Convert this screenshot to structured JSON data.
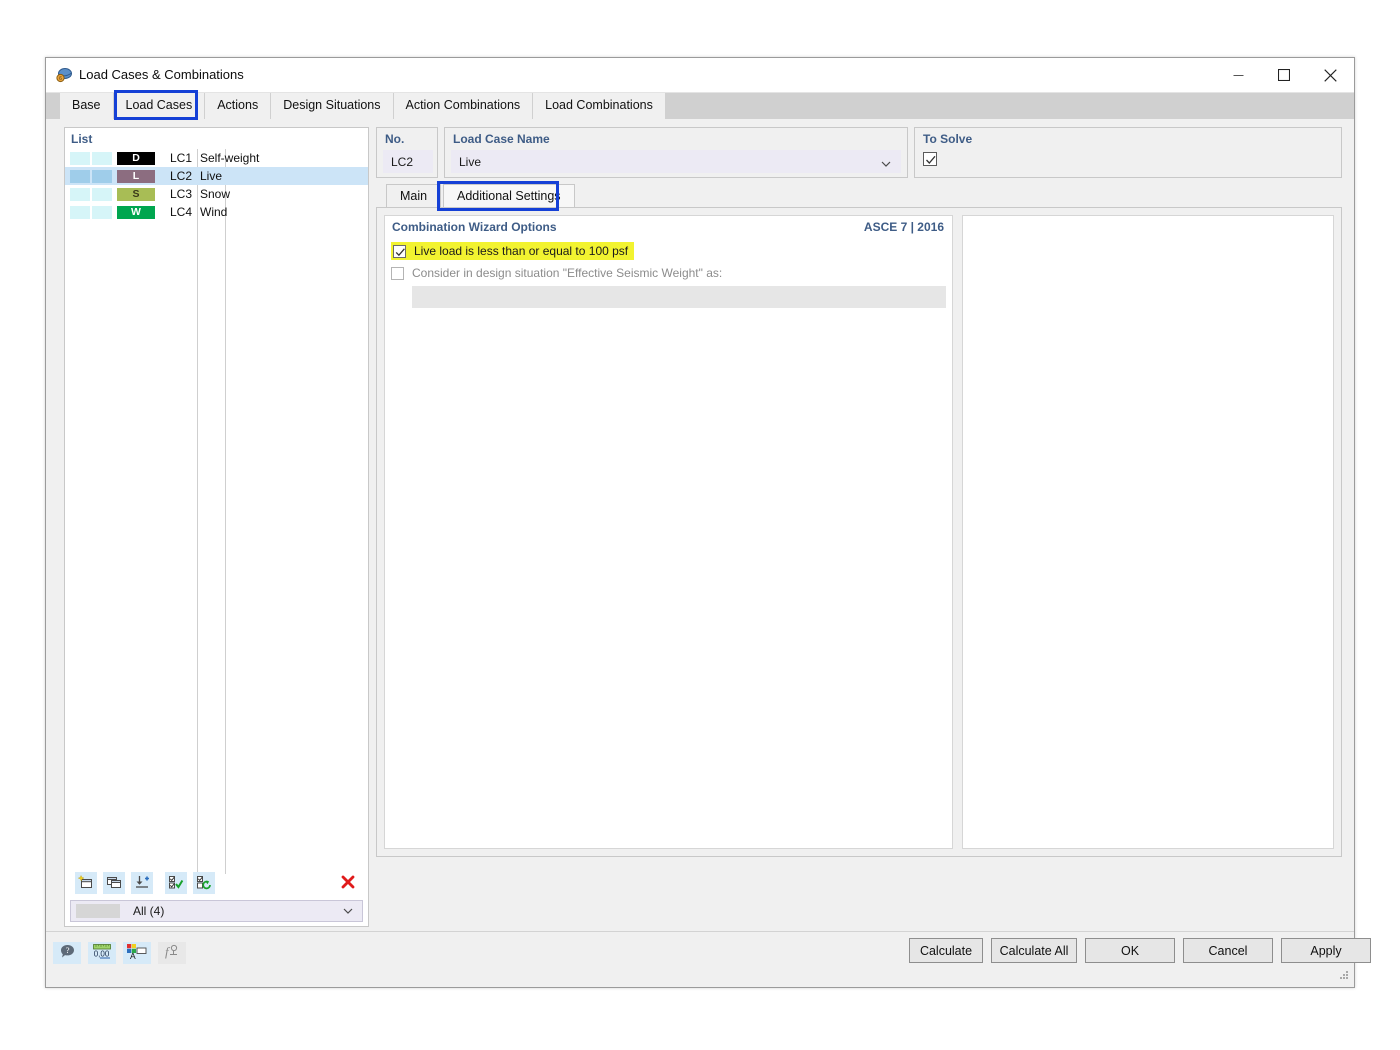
{
  "window": {
    "title": "Load Cases & Combinations",
    "icon": "app-icon",
    "minimize": "—",
    "maximize": "☐",
    "close": "✕"
  },
  "tabs": [
    {
      "label": "Base",
      "active": false
    },
    {
      "label": "Load Cases",
      "active": true,
      "annotated": true
    },
    {
      "label": "Actions",
      "active": false
    },
    {
      "label": "Design Situations",
      "active": false
    },
    {
      "label": "Action Combinations",
      "active": false
    },
    {
      "label": "Load Combinations",
      "active": false
    }
  ],
  "list": {
    "header": "List",
    "rows": [
      {
        "sw1": "#d6f5f8",
        "sw2": "#d6f5f8",
        "badge": "D",
        "badge_bg": "#000000",
        "badge_fg": "#ffffff",
        "no": "LC1",
        "name": "Self-weight",
        "selected": false
      },
      {
        "sw1": "#9fcdea",
        "sw2": "#9fcdea",
        "badge": "L",
        "badge_bg": "#8c6d80",
        "badge_fg": "#ffffff",
        "no": "LC2",
        "name": "Live",
        "selected": true
      },
      {
        "sw1": "#d6f5f8",
        "sw2": "#d6f5f8",
        "badge": "S",
        "badge_bg": "#a8bd55",
        "badge_fg": "#3a3a1a",
        "no": "LC3",
        "name": "Snow",
        "selected": false
      },
      {
        "sw1": "#d6f5f8",
        "sw2": "#d6f5f8",
        "badge": "W",
        "badge_bg": "#00a64f",
        "badge_fg": "#ffffff",
        "no": "LC4",
        "name": "Wind",
        "selected": false
      }
    ],
    "toolbar": [
      {
        "name": "new-load-case-button",
        "icon": "new-window-icon"
      },
      {
        "name": "duplicate-load-case-button",
        "icon": "copy-window-icon"
      },
      {
        "name": "import-load-case-button",
        "icon": "import-icon"
      },
      {
        "name": "select-all-button",
        "icon": "checklist-check-icon"
      },
      {
        "name": "invert-selection-button",
        "icon": "checklist-refresh-icon"
      },
      {
        "name": "delete-load-case-button",
        "icon": "red-x-icon"
      }
    ],
    "filter": {
      "value": "All (4)",
      "arrow": "chevron-down-icon"
    }
  },
  "detail": {
    "no": {
      "label": "No.",
      "value": "LC2"
    },
    "name": {
      "label": "Load Case Name",
      "value": "Live",
      "arrow": "chevron-down-icon"
    },
    "to_solve": {
      "label": "To Solve",
      "checked": true
    }
  },
  "inner_tabs": [
    {
      "label": "Main",
      "active": false
    },
    {
      "label": "Additional Settings",
      "active": true,
      "annotated": true
    }
  ],
  "wizard": {
    "title": "Combination Wizard Options",
    "standard": "ASCE 7 | 2016",
    "options": [
      {
        "label": "Live load is less than or equal to 100 psf",
        "checked": true,
        "highlighted": true,
        "disabled": false
      },
      {
        "label": "Consider in design situation \"Effective Seismic Weight\" as:",
        "checked": false,
        "highlighted": false,
        "disabled": true
      }
    ],
    "seismic_field_value": ""
  },
  "footer": {
    "icons": [
      {
        "name": "help-info-button",
        "icon": "question-bubble-icon",
        "enabled": true
      },
      {
        "name": "units-button",
        "icon": "ruler-number-icon",
        "enabled": true
      },
      {
        "name": "colors-button",
        "icon": "color-palette-icon",
        "enabled": true
      },
      {
        "name": "formula-button",
        "icon": "function-icon",
        "enabled": false
      }
    ],
    "buttons": [
      {
        "label": "Calculate",
        "name": "calculate-button"
      },
      {
        "label": "Calculate All",
        "name": "calculate-all-button"
      },
      {
        "label": "OK",
        "name": "ok-button"
      },
      {
        "label": "Cancel",
        "name": "cancel-button"
      },
      {
        "label": "Apply",
        "name": "apply-button"
      }
    ]
  },
  "colors": {
    "annotation": "#1540d6",
    "highlight": "#f2f330",
    "selection": "#cce4f7",
    "label_blue": "#3e5c86"
  }
}
